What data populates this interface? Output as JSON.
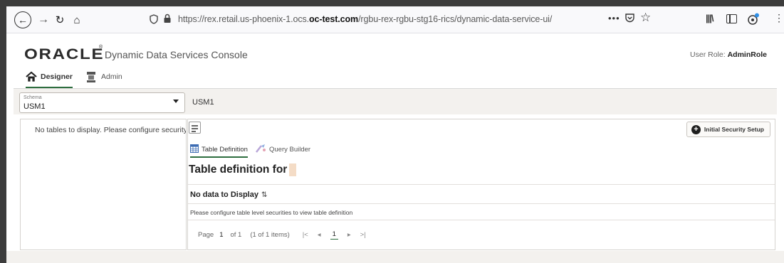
{
  "browser": {
    "url_prefix": "https://rex.retail.us-phoenix-1.ocs.",
    "url_domain": "oc-test.com",
    "url_suffix": "/rgbu-rex-rgbu-stg16-rics/dynamic-data-service-ui/",
    "more_glyph": "•••"
  },
  "app": {
    "logo_text": "ORACLE",
    "title": "Dynamic Data Services Console",
    "user_role_label": "User Role:",
    "user_role_value": "AdminRole"
  },
  "nav": {
    "tabs": [
      {
        "label": "Designer",
        "icon": "home-icon",
        "active": true
      },
      {
        "label": "Admin",
        "icon": "admin-icon",
        "active": false
      }
    ]
  },
  "schema": {
    "label": "Schema",
    "value": "USM1",
    "selected_name": "USM1"
  },
  "left_panel": {
    "message": "No tables to display. Please configure security permissions."
  },
  "main": {
    "initial_setup_label": "Initial Security Setup",
    "sub_tabs": [
      {
        "label": "Table Definition",
        "icon": "table-icon",
        "active": true
      },
      {
        "label": "Query Builder",
        "icon": "query-builder-icon",
        "active": false
      }
    ],
    "heading": "Table definition for",
    "grid_header": "No data to Display",
    "grid_message": "Please configure table level securities to view table definition",
    "pager": {
      "page_label": "Page",
      "page_number": "1",
      "of_label": "of 1",
      "items_label": "(1 of 1 items)",
      "first_glyph": "|<",
      "prev_glyph": "◂",
      "current_page": "1",
      "next_glyph": "▸",
      "last_glyph": ">|"
    }
  },
  "colors": {
    "accent_green": "#2d6e3f",
    "panel_bg": "#f3f1ee"
  }
}
